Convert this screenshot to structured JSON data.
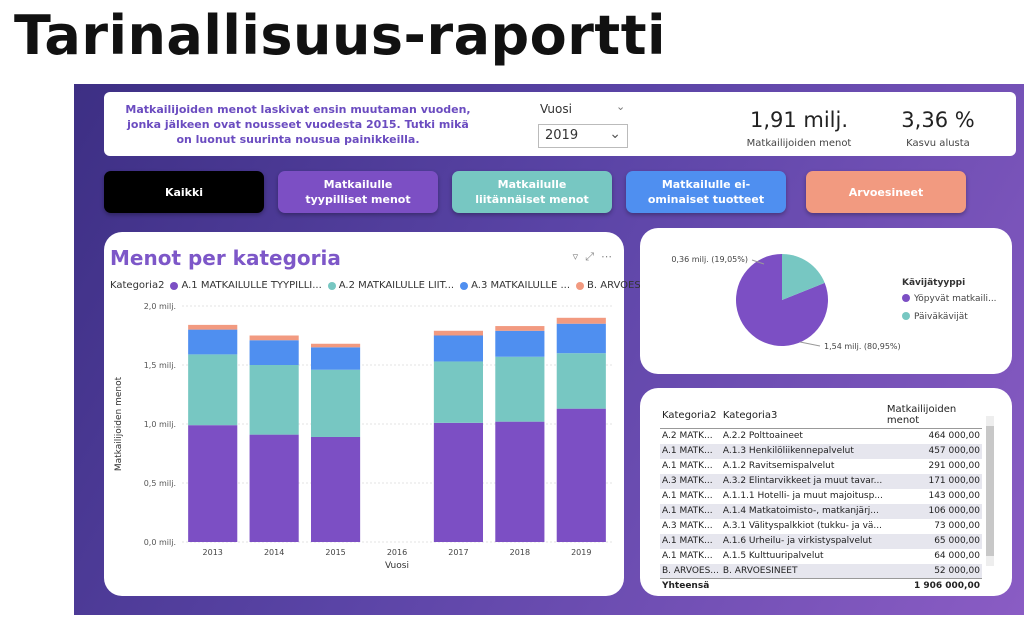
{
  "page_title": "Tarinallisuus-raportti",
  "intro_text": "Matkailijoiden menot laskivat ensin muutaman vuoden, jonka jälkeen ovat nousseet vuodesta 2015. Tutki mikä on luonut suurinta nousua painikkeilla.",
  "year_filter": {
    "label": "Vuosi",
    "value": "2019"
  },
  "kpis": [
    {
      "value": "1,91 milj.",
      "label": "Matkailijoiden menot"
    },
    {
      "value": "3,36 %",
      "label": "Kasvu alusta"
    }
  ],
  "buttons": [
    {
      "label": "Kaikki",
      "color": "#000000"
    },
    {
      "label": "Matkailulle tyypilliset menot",
      "color": "#7c4fc4"
    },
    {
      "label": "Matkailulle liitännäiset menot",
      "color": "#77c7c2"
    },
    {
      "label": "Matkailulle ei-ominaiset tuotteet",
      "color": "#4f8ff0"
    },
    {
      "label": "Arvoesineet",
      "color": "#f29a80"
    }
  ],
  "chart_data": [
    {
      "type": "bar",
      "stacked": true,
      "title": "Menot per kategoria",
      "legend_title": "Kategoria2",
      "legend": [
        "A.1 MATKAILULLE TYYPILLI...",
        "A.2 MATKAILULLE LIIT...",
        "A.3 MATKAILULLE ...",
        "B. ARVOESINEET"
      ],
      "categories": [
        "2013",
        "2014",
        "2015",
        "2016",
        "2017",
        "2018",
        "2019"
      ],
      "xlabel": "Vuosi",
      "ylabel": "Matkailijoiden menot",
      "ylim": [
        0,
        2.0
      ],
      "yticks": [
        "0,0 milj.",
        "0,5 milj.",
        "1,0 milj.",
        "1,5 milj.",
        "2,0 milj."
      ],
      "series": [
        {
          "name": "A.1 MATKAILULLE TYYPILLI...",
          "color": "#7c4fc4",
          "values": [
            0.99,
            0.91,
            0.89,
            0,
            1.01,
            1.02,
            1.13
          ]
        },
        {
          "name": "A.2 MATKAILULLE LIIT...",
          "color": "#77c7c2",
          "values": [
            0.6,
            0.59,
            0.57,
            0,
            0.52,
            0.55,
            0.47
          ]
        },
        {
          "name": "A.3 MATKAILULLE ...",
          "color": "#4f8ff0",
          "values": [
            0.21,
            0.21,
            0.19,
            0,
            0.22,
            0.22,
            0.25
          ]
        },
        {
          "name": "B. ARVOESINEET",
          "color": "#f29a80",
          "values": [
            0.04,
            0.04,
            0.03,
            0,
            0.04,
            0.04,
            0.05
          ]
        }
      ]
    },
    {
      "type": "pie",
      "legend_title": "Kävijätyyppi",
      "slices": [
        {
          "name": "Yöpyvät matkaili...",
          "value": 1.54,
          "label": "1,54 milj. (80,95%)",
          "color": "#7c4fc4"
        },
        {
          "name": "Päiväkävijät",
          "value": 0.36,
          "label": "0,36 milj. (19,05%)",
          "color": "#77c7c2"
        }
      ]
    }
  ],
  "table": {
    "headers": [
      "Kategoria2",
      "Kategoria3",
      "Matkailijoiden menot"
    ],
    "rows": [
      [
        "A.2 MATK...",
        "A.2.2 Polttoaineet",
        "464 000,00"
      ],
      [
        "A.1 MATK...",
        "A.1.3 Henkilöliikennepalvelut",
        "457 000,00"
      ],
      [
        "A.1 MATK...",
        "A.1.2 Ravitsemispalvelut",
        "291 000,00"
      ],
      [
        "A.3 MATK...",
        "A.3.2 Elintarvikkeet ja muut tavar...",
        "171 000,00"
      ],
      [
        "A.1 MATK...",
        "A.1.1.1 Hotelli- ja muut majoitusp...",
        "143 000,00"
      ],
      [
        "A.1 MATK...",
        "A.1.4 Matkatoimisto-, matkanjärj...",
        "106 000,00"
      ],
      [
        "A.3 MATK...",
        "A.3.1 Välityspalkkiot (tukku- ja vä...",
        "73 000,00"
      ],
      [
        "A.1 MATK...",
        "A.1.6 Urheilu- ja virkistyspalvelut",
        "65 000,00"
      ],
      [
        "A.1 MATK...",
        "A.1.5 Kulttuuripalvelut",
        "64 000,00"
      ],
      [
        "B. ARVOES...",
        "B. ARVOESINEET",
        "52 000,00"
      ]
    ],
    "total_label": "Yhteensä",
    "total_value": "1 906 000,00"
  }
}
